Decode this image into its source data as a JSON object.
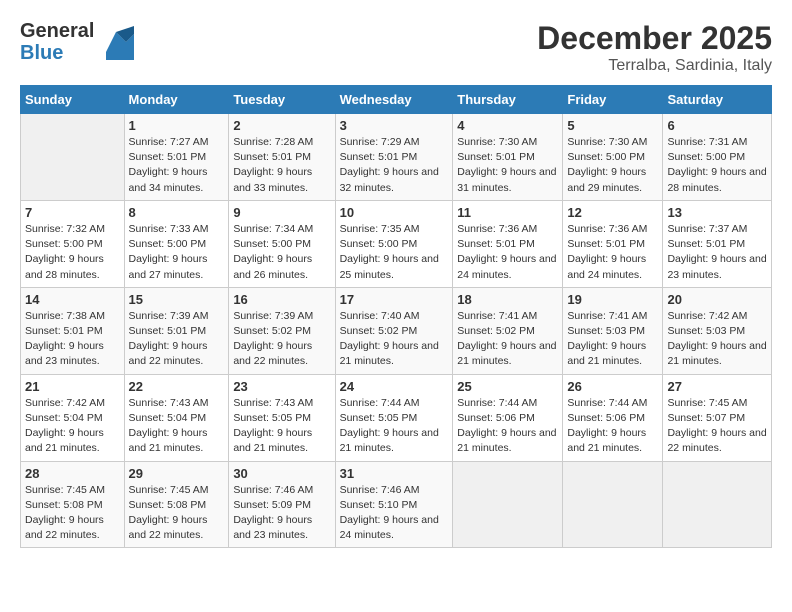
{
  "header": {
    "logo_line1": "General",
    "logo_line2": "Blue",
    "month": "December 2025",
    "location": "Terralba, Sardinia, Italy"
  },
  "weekdays": [
    "Sunday",
    "Monday",
    "Tuesday",
    "Wednesday",
    "Thursday",
    "Friday",
    "Saturday"
  ],
  "weeks": [
    [
      {
        "day": "",
        "sunrise": "",
        "sunset": "",
        "daylight": ""
      },
      {
        "day": "1",
        "sunrise": "7:27 AM",
        "sunset": "5:01 PM",
        "daylight": "9 hours and 34 minutes."
      },
      {
        "day": "2",
        "sunrise": "7:28 AM",
        "sunset": "5:01 PM",
        "daylight": "9 hours and 33 minutes."
      },
      {
        "day": "3",
        "sunrise": "7:29 AM",
        "sunset": "5:01 PM",
        "daylight": "9 hours and 32 minutes."
      },
      {
        "day": "4",
        "sunrise": "7:30 AM",
        "sunset": "5:01 PM",
        "daylight": "9 hours and 31 minutes."
      },
      {
        "day": "5",
        "sunrise": "7:30 AM",
        "sunset": "5:00 PM",
        "daylight": "9 hours and 29 minutes."
      },
      {
        "day": "6",
        "sunrise": "7:31 AM",
        "sunset": "5:00 PM",
        "daylight": "9 hours and 28 minutes."
      }
    ],
    [
      {
        "day": "7",
        "sunrise": "7:32 AM",
        "sunset": "5:00 PM",
        "daylight": "9 hours and 28 minutes."
      },
      {
        "day": "8",
        "sunrise": "7:33 AM",
        "sunset": "5:00 PM",
        "daylight": "9 hours and 27 minutes."
      },
      {
        "day": "9",
        "sunrise": "7:34 AM",
        "sunset": "5:00 PM",
        "daylight": "9 hours and 26 minutes."
      },
      {
        "day": "10",
        "sunrise": "7:35 AM",
        "sunset": "5:00 PM",
        "daylight": "9 hours and 25 minutes."
      },
      {
        "day": "11",
        "sunrise": "7:36 AM",
        "sunset": "5:01 PM",
        "daylight": "9 hours and 24 minutes."
      },
      {
        "day": "12",
        "sunrise": "7:36 AM",
        "sunset": "5:01 PM",
        "daylight": "9 hours and 24 minutes."
      },
      {
        "day": "13",
        "sunrise": "7:37 AM",
        "sunset": "5:01 PM",
        "daylight": "9 hours and 23 minutes."
      }
    ],
    [
      {
        "day": "14",
        "sunrise": "7:38 AM",
        "sunset": "5:01 PM",
        "daylight": "9 hours and 23 minutes."
      },
      {
        "day": "15",
        "sunrise": "7:39 AM",
        "sunset": "5:01 PM",
        "daylight": "9 hours and 22 minutes."
      },
      {
        "day": "16",
        "sunrise": "7:39 AM",
        "sunset": "5:02 PM",
        "daylight": "9 hours and 22 minutes."
      },
      {
        "day": "17",
        "sunrise": "7:40 AM",
        "sunset": "5:02 PM",
        "daylight": "9 hours and 21 minutes."
      },
      {
        "day": "18",
        "sunrise": "7:41 AM",
        "sunset": "5:02 PM",
        "daylight": "9 hours and 21 minutes."
      },
      {
        "day": "19",
        "sunrise": "7:41 AM",
        "sunset": "5:03 PM",
        "daylight": "9 hours and 21 minutes."
      },
      {
        "day": "20",
        "sunrise": "7:42 AM",
        "sunset": "5:03 PM",
        "daylight": "9 hours and 21 minutes."
      }
    ],
    [
      {
        "day": "21",
        "sunrise": "7:42 AM",
        "sunset": "5:04 PM",
        "daylight": "9 hours and 21 minutes."
      },
      {
        "day": "22",
        "sunrise": "7:43 AM",
        "sunset": "5:04 PM",
        "daylight": "9 hours and 21 minutes."
      },
      {
        "day": "23",
        "sunrise": "7:43 AM",
        "sunset": "5:05 PM",
        "daylight": "9 hours and 21 minutes."
      },
      {
        "day": "24",
        "sunrise": "7:44 AM",
        "sunset": "5:05 PM",
        "daylight": "9 hours and 21 minutes."
      },
      {
        "day": "25",
        "sunrise": "7:44 AM",
        "sunset": "5:06 PM",
        "daylight": "9 hours and 21 minutes."
      },
      {
        "day": "26",
        "sunrise": "7:44 AM",
        "sunset": "5:06 PM",
        "daylight": "9 hours and 21 minutes."
      },
      {
        "day": "27",
        "sunrise": "7:45 AM",
        "sunset": "5:07 PM",
        "daylight": "9 hours and 22 minutes."
      }
    ],
    [
      {
        "day": "28",
        "sunrise": "7:45 AM",
        "sunset": "5:08 PM",
        "daylight": "9 hours and 22 minutes."
      },
      {
        "day": "29",
        "sunrise": "7:45 AM",
        "sunset": "5:08 PM",
        "daylight": "9 hours and 22 minutes."
      },
      {
        "day": "30",
        "sunrise": "7:46 AM",
        "sunset": "5:09 PM",
        "daylight": "9 hours and 23 minutes."
      },
      {
        "day": "31",
        "sunrise": "7:46 AM",
        "sunset": "5:10 PM",
        "daylight": "9 hours and 24 minutes."
      },
      {
        "day": "",
        "sunrise": "",
        "sunset": "",
        "daylight": ""
      },
      {
        "day": "",
        "sunrise": "",
        "sunset": "",
        "daylight": ""
      },
      {
        "day": "",
        "sunrise": "",
        "sunset": "",
        "daylight": ""
      }
    ]
  ],
  "labels": {
    "sunrise": "Sunrise:",
    "sunset": "Sunset:",
    "daylight": "Daylight:"
  }
}
